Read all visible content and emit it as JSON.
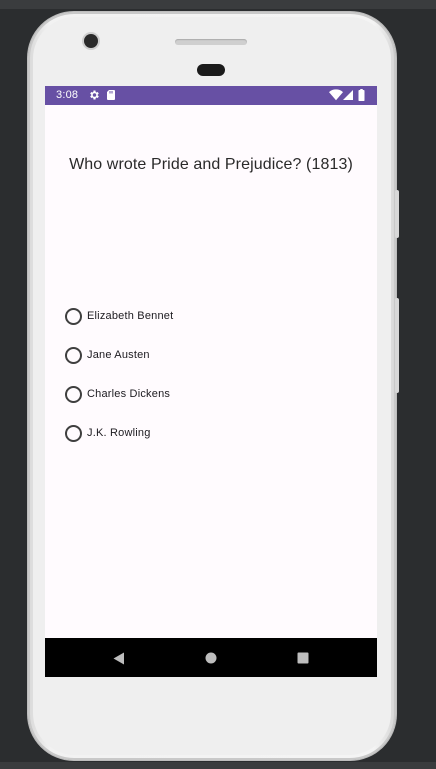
{
  "status_bar": {
    "time": "3:08",
    "color": "#6750a4",
    "icons": [
      "settings-icon",
      "sd-card-icon",
      "wifi-icon",
      "signal-icon",
      "battery-icon"
    ]
  },
  "quiz": {
    "question": "Who wrote Pride and Prejudice? (1813)",
    "options": [
      "Elizabeth Bennet",
      "Jane Austen",
      "Charles Dickens",
      "J.K. Rowling"
    ]
  },
  "nav_bar": {
    "buttons": [
      "back-icon",
      "home-icon",
      "recents-icon"
    ]
  }
}
